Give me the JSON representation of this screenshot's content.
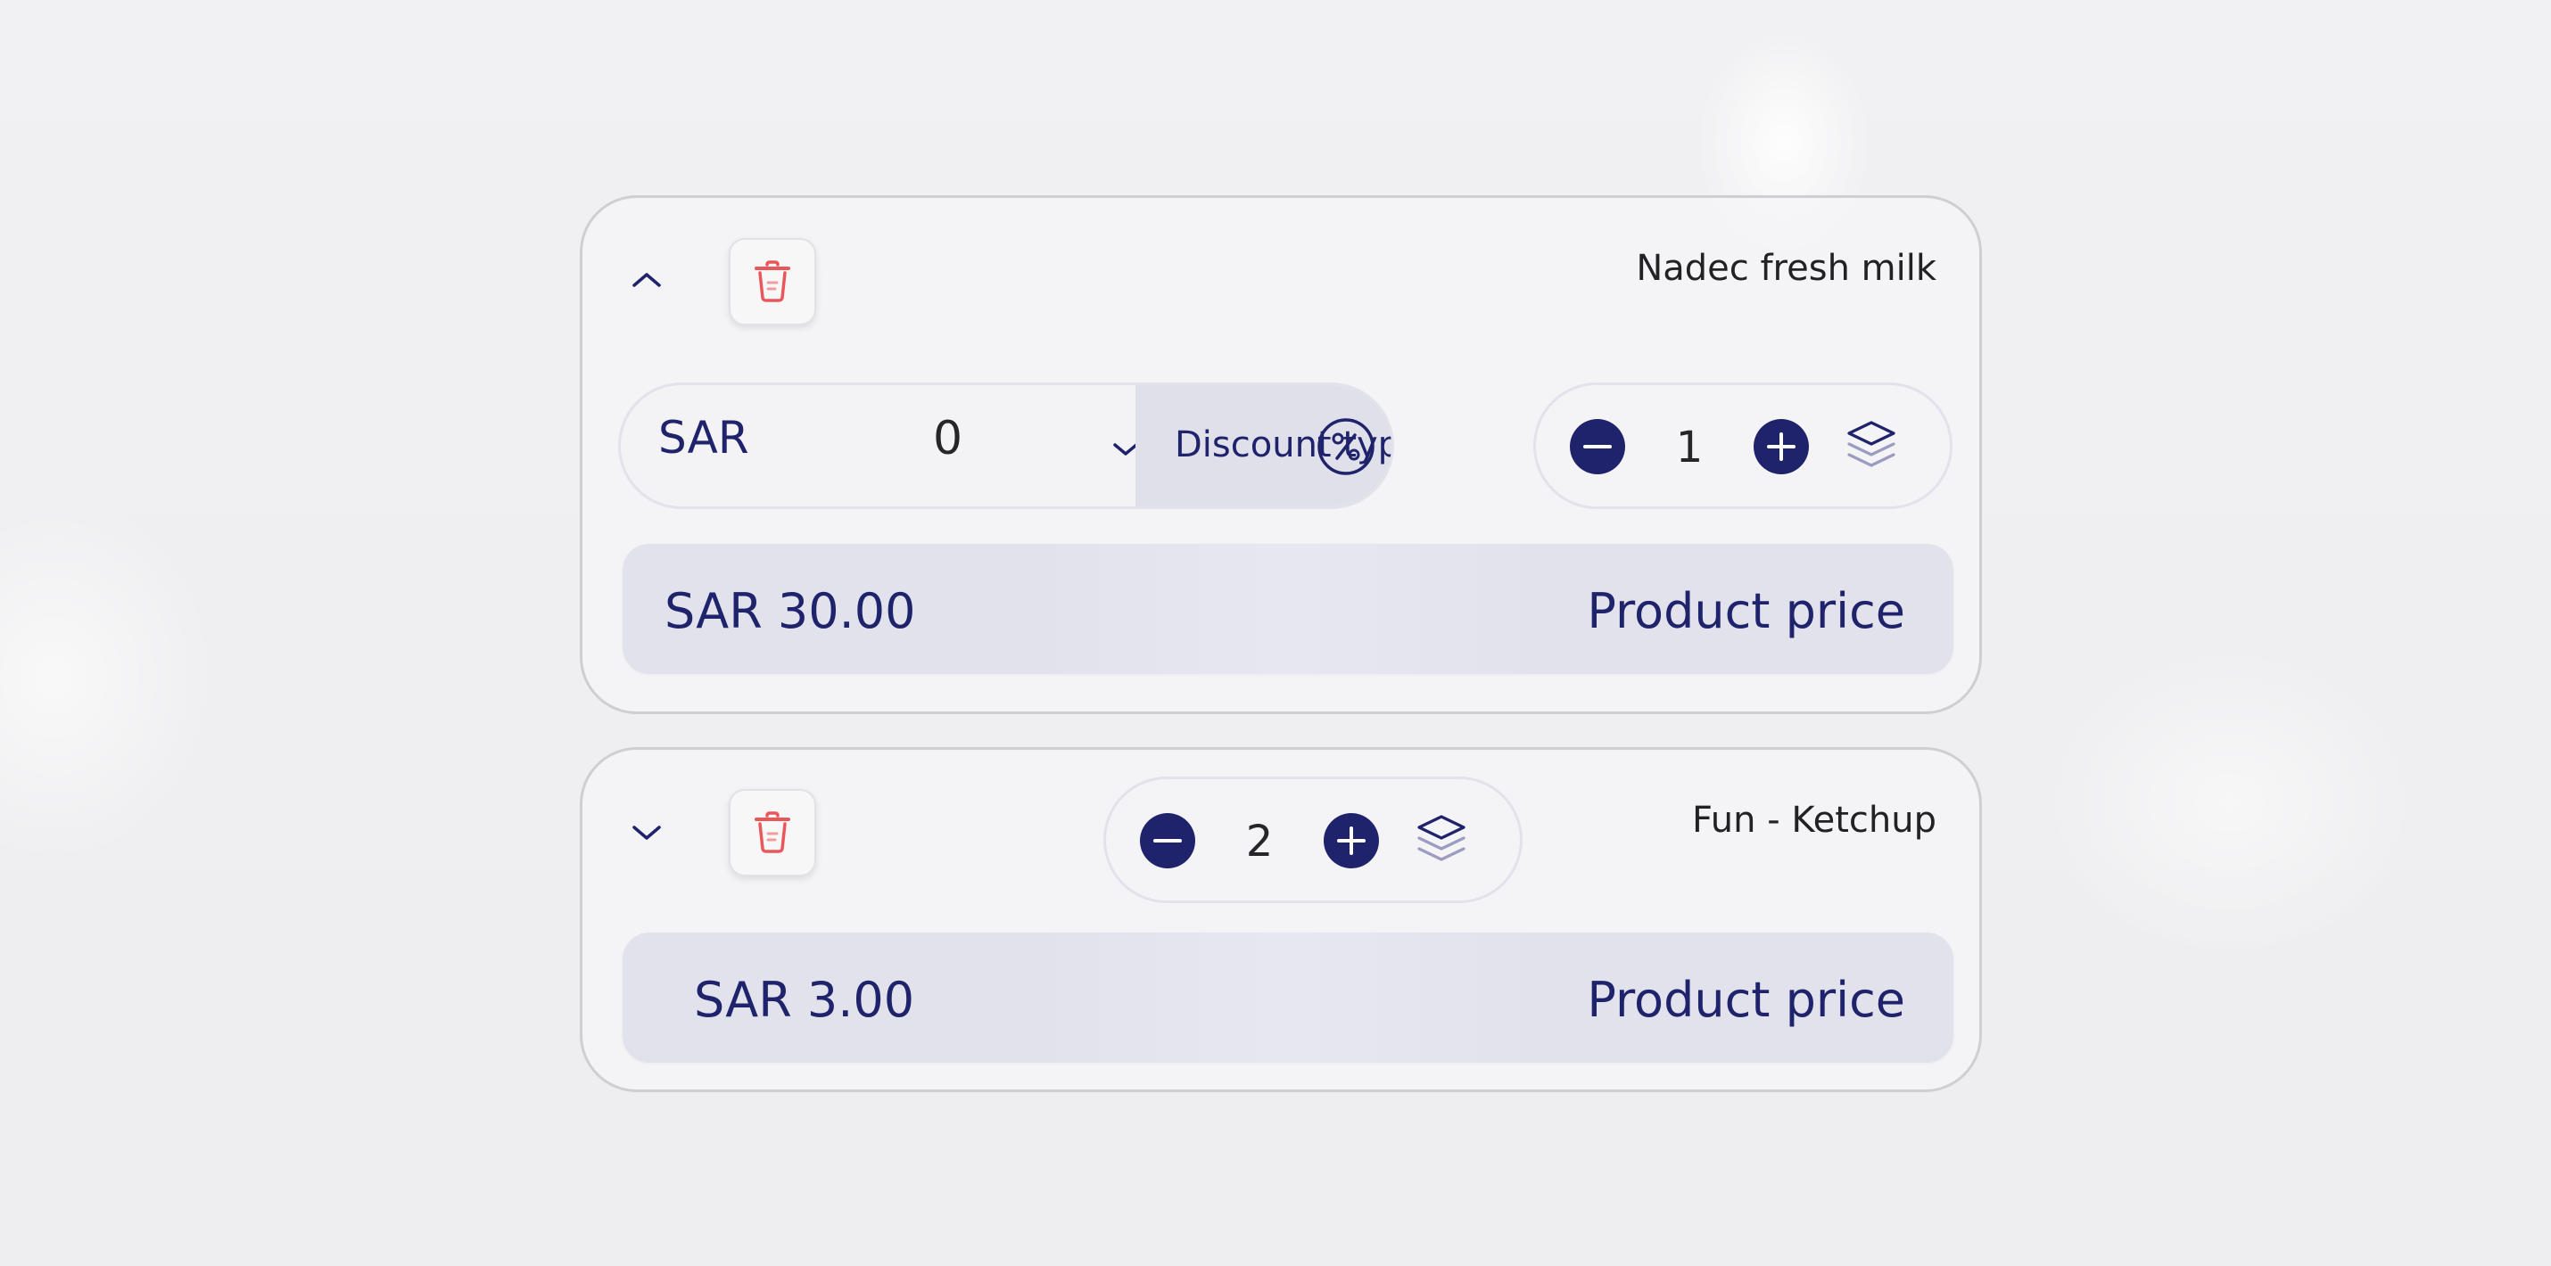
{
  "colors": {
    "primary": "#1f236b",
    "delete": "#e9575b",
    "price_bar": "#e2e2ec",
    "card_border": "#cfcfd3"
  },
  "items": [
    {
      "name": "Nadec fresh milk",
      "expanded": true,
      "discount": {
        "currency": "SAR",
        "value": "0",
        "type_label": "Discount type",
        "type_icon": "percent-icon"
      },
      "quantity": "1",
      "price": {
        "value": "SAR 30.00",
        "label": "Product price"
      }
    },
    {
      "name": "Fun - Ketchup",
      "expanded": false,
      "quantity": "2",
      "price": {
        "value": "SAR 3.00",
        "label": "Product price"
      }
    }
  ],
  "icons": {
    "expand_toggle_open": "chevron-up-icon",
    "expand_toggle_closed": "chevron-down-icon",
    "delete": "trash-icon",
    "decrease": "minus-icon",
    "increase": "plus-icon",
    "stack": "layers-icon"
  }
}
